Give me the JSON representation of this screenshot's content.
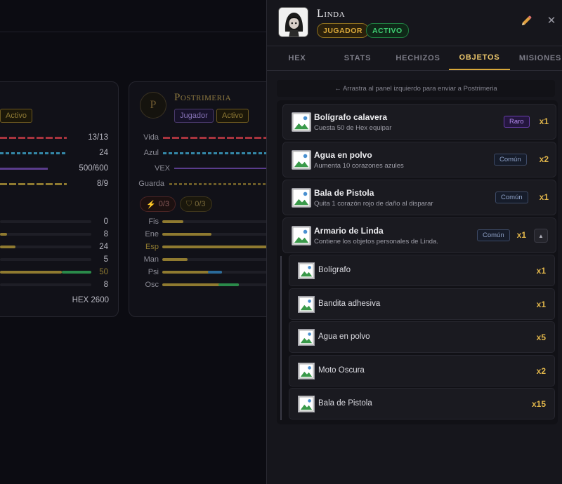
{
  "background": {
    "left_card": {
      "badge_activo": "Activo",
      "values": [
        "13/13",
        "24",
        "500/600",
        "8/9"
      ],
      "attr_values": [
        "0",
        "8",
        "24",
        "5",
        "50",
        "8"
      ],
      "hex": "HEX 2600"
    },
    "right_card": {
      "initial": "P",
      "name": "Postrimeria",
      "badge_jugador": "Jugador",
      "badge_activo": "Activo",
      "stat_labels": [
        "Vida",
        "Azul",
        "VEX",
        "Guarda"
      ],
      "pill1": "0/3",
      "pill2": "0/3",
      "attrs": [
        {
          "label": "Fis",
          "fill": 0.2
        },
        {
          "label": "Ene",
          "fill": 0.47
        },
        {
          "label": "Esp",
          "fill": 1.0
        },
        {
          "label": "Man",
          "fill": 0.24
        },
        {
          "label": "Psi",
          "fill": 0.57
        },
        {
          "label": "Osc",
          "fill": 0.73
        }
      ]
    }
  },
  "panel": {
    "name": "Linda",
    "badge_jugador": "JUGADOR",
    "badge_activo": "ACTIVO",
    "tabs": [
      {
        "label": "HEX"
      },
      {
        "label": "STATS"
      },
      {
        "label": "HECHIZOS"
      },
      {
        "label": "OBJETOS",
        "active": true
      },
      {
        "label": "MISIONES"
      }
    ],
    "hint": "← Arrastra al panel izquierdo para enviar a Postrimeria",
    "items": [
      {
        "name": "Bolígrafo calavera",
        "desc": "Cuesta 50 de Hex equipar",
        "rarity": "Raro",
        "qty": "x1"
      },
      {
        "name": "Agua en polvo",
        "desc": "Aumenta 10 corazones azules",
        "rarity": "Común",
        "qty": "x2"
      },
      {
        "name": "Bala de Pistola",
        "desc": "Quita 1 corazón rojo de daño al disparar",
        "rarity": "Común",
        "qty": "x1"
      },
      {
        "name": "Armario de Linda",
        "desc": "Contiene los objetos personales de Linda.",
        "rarity": "Común",
        "qty": "x1",
        "expand_icon": "▲"
      }
    ],
    "subitems": [
      {
        "name": "Bolígrafo",
        "qty": "x1"
      },
      {
        "name": "Bandita adhesiva",
        "qty": "x1"
      },
      {
        "name": "Agua en polvo",
        "qty": "x5"
      },
      {
        "name": "Moto Oscura",
        "qty": "x2"
      },
      {
        "name": "Bala de Pistola",
        "qty": "x15"
      }
    ]
  },
  "colors": {
    "accent_gold": "#e0b54a",
    "active_green": "#3fcf73",
    "rare_purple": "#b58cf0"
  }
}
